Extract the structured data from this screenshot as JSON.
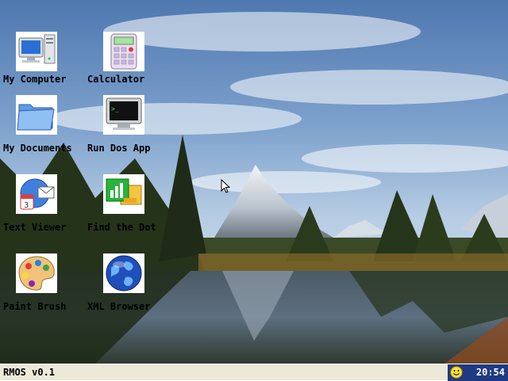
{
  "desktop": {
    "icons": [
      {
        "label": "My Computer",
        "icon": "computer-icon"
      },
      {
        "label": "Calculator",
        "icon": "calculator-icon"
      },
      {
        "label": "My Documents",
        "icon": "folder-icon"
      },
      {
        "label": "Run Dos App",
        "icon": "terminal-icon"
      },
      {
        "label": "Text Viewer",
        "icon": "text-viewer-icon"
      },
      {
        "label": "Find the Dot",
        "icon": "find-the-dot-icon"
      },
      {
        "label": "Paint Brush",
        "icon": "palette-icon"
      },
      {
        "label": "XML Browser",
        "icon": "globe-icon"
      }
    ]
  },
  "taskbar": {
    "os_label": "RMOS v0.1",
    "clock": "20:54",
    "tray_icon": "smiley-icon",
    "tray_color": "#1f3a82"
  },
  "wallpaper": {
    "subject": "mountain lake landscape"
  }
}
